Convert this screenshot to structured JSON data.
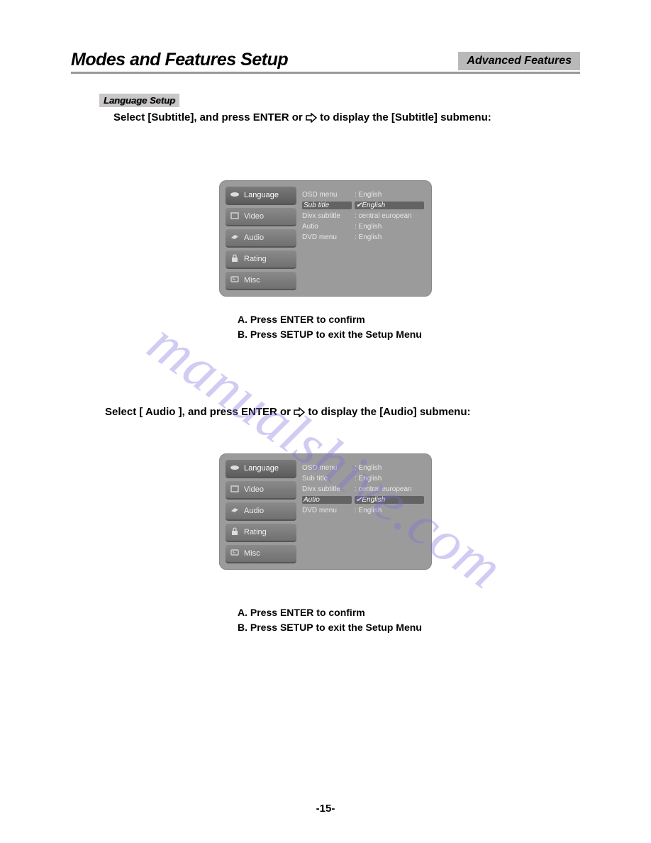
{
  "header": {
    "title": "Modes and Features Setup",
    "badge": "Advanced Features"
  },
  "subheading": "Language Setup",
  "section1": {
    "pre": "Select [Subtitle], and press ",
    "enter": "ENTER",
    "mid": " or ",
    "post": " to display the [Subtitle] submenu:"
  },
  "section2": {
    "pre": "Select [  Audio  ], and press ",
    "enter": "ENTER",
    "mid": " or ",
    "post": "  to display the [Audio] submenu:"
  },
  "osd": {
    "tabs": [
      {
        "icon": "lips",
        "label": "Language"
      },
      {
        "icon": "tv",
        "label": "Video"
      },
      {
        "icon": "horn",
        "label": "Audio"
      },
      {
        "icon": "lock",
        "label": "Rating"
      },
      {
        "icon": "note",
        "label": "Misc"
      }
    ],
    "rows1": [
      {
        "label": "OSD menu",
        "value": ": English",
        "sel": false
      },
      {
        "label": "Sub title",
        "value": "✔English",
        "sel": true
      },
      {
        "label": "Divx subtitle",
        "value": ": central european",
        "sel": false
      },
      {
        "label": "Autio",
        "value": ": English",
        "sel": false
      },
      {
        "label": "DVD menu",
        "value": ": English",
        "sel": false
      }
    ],
    "rows2": [
      {
        "label": "OSD menu",
        "value": ": English",
        "sel": false
      },
      {
        "label": "Sub title",
        "value": ": English",
        "sel": false
      },
      {
        "label": "Divx subtitle",
        "value": ": central european",
        "sel": false
      },
      {
        "label": "Autio",
        "value": "✔English",
        "sel": true
      },
      {
        "label": "DVD menu",
        "value": ": English",
        "sel": false
      }
    ]
  },
  "steps": {
    "a_pre": "A.  Press ",
    "a_bold": "ENTER",
    "a_post": " to confirm",
    "b_pre": "B.  Press ",
    "b_bold": "SETUP",
    "b_post": " to exit the Setup Menu"
  },
  "watermark": "manualshive.com",
  "page_number": "-15-"
}
